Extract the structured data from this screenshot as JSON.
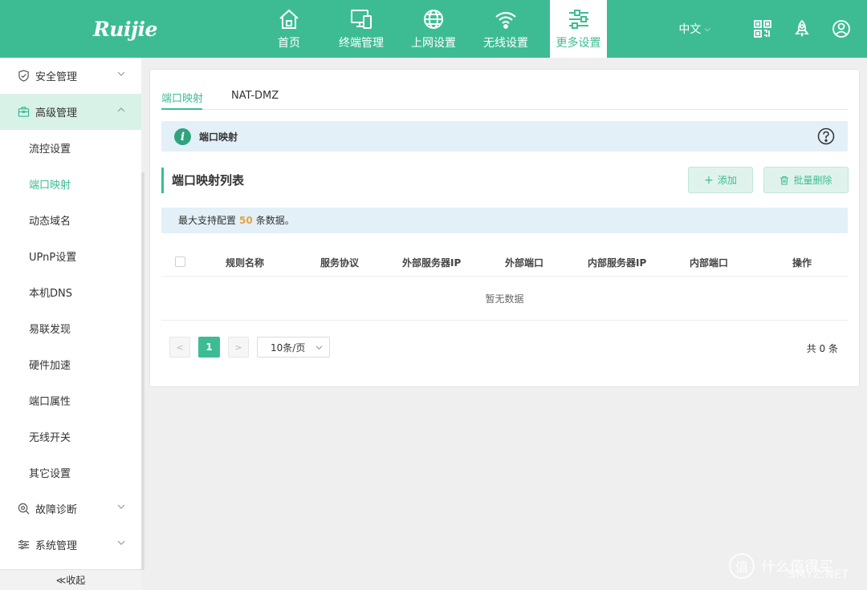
{
  "brand": {
    "logo": "Ruijie"
  },
  "nav": {
    "items": [
      {
        "label": "首页",
        "icon": "home-icon"
      },
      {
        "label": "终端管理",
        "icon": "devices-icon"
      },
      {
        "label": "上网设置",
        "icon": "globe-icon"
      },
      {
        "label": "无线设置",
        "icon": "wifi-icon"
      },
      {
        "label": "更多设置",
        "icon": "sliders-icon",
        "active": true
      }
    ]
  },
  "topright": {
    "lang": "中文",
    "icons": [
      "qr-code-icon",
      "rocket-icon",
      "user-icon"
    ]
  },
  "sidebar": {
    "groups": [
      {
        "label": "安全管理",
        "icon": "shield-icon"
      },
      {
        "label": "高级管理",
        "icon": "toolbox-icon",
        "active": true
      },
      {
        "label": "故障诊断",
        "icon": "diagnose-icon"
      },
      {
        "label": "系统管理",
        "icon": "settings-icon"
      }
    ],
    "items": [
      "流控设置",
      "端口映射",
      "动态域名",
      "UPnP设置",
      "本机DNS",
      "易联发现",
      "硬件加速",
      "端口属性",
      "无线开关",
      "其它设置"
    ],
    "active_item": "端口映射",
    "collapse_label": "≪收起"
  },
  "tabs": [
    {
      "label": "端口映射",
      "active": true
    },
    {
      "label": "NAT-DMZ"
    }
  ],
  "info": {
    "title": "端口映射"
  },
  "section": {
    "title": "端口映射列表",
    "add_label": "添加",
    "batch_delete_label": "批量删除"
  },
  "notice": {
    "prefix": "最大支持配置",
    "count": "50",
    "suffix": "条数据。"
  },
  "table": {
    "columns": [
      "规则名称",
      "服务协议",
      "外部服务器IP",
      "外部端口",
      "内部服务器IP",
      "内部端口",
      "操作"
    ],
    "empty_text": "暂无数据"
  },
  "pagination": {
    "current": "1",
    "page_size": "10条/页",
    "total": "共 0 条"
  },
  "watermark": {
    "text": "什么值得买",
    "site": "SMYZ.NET"
  },
  "colors": {
    "primary": "#3dbc94",
    "info_bg": "#e3f0f8",
    "highlight": "#e6a23c"
  }
}
